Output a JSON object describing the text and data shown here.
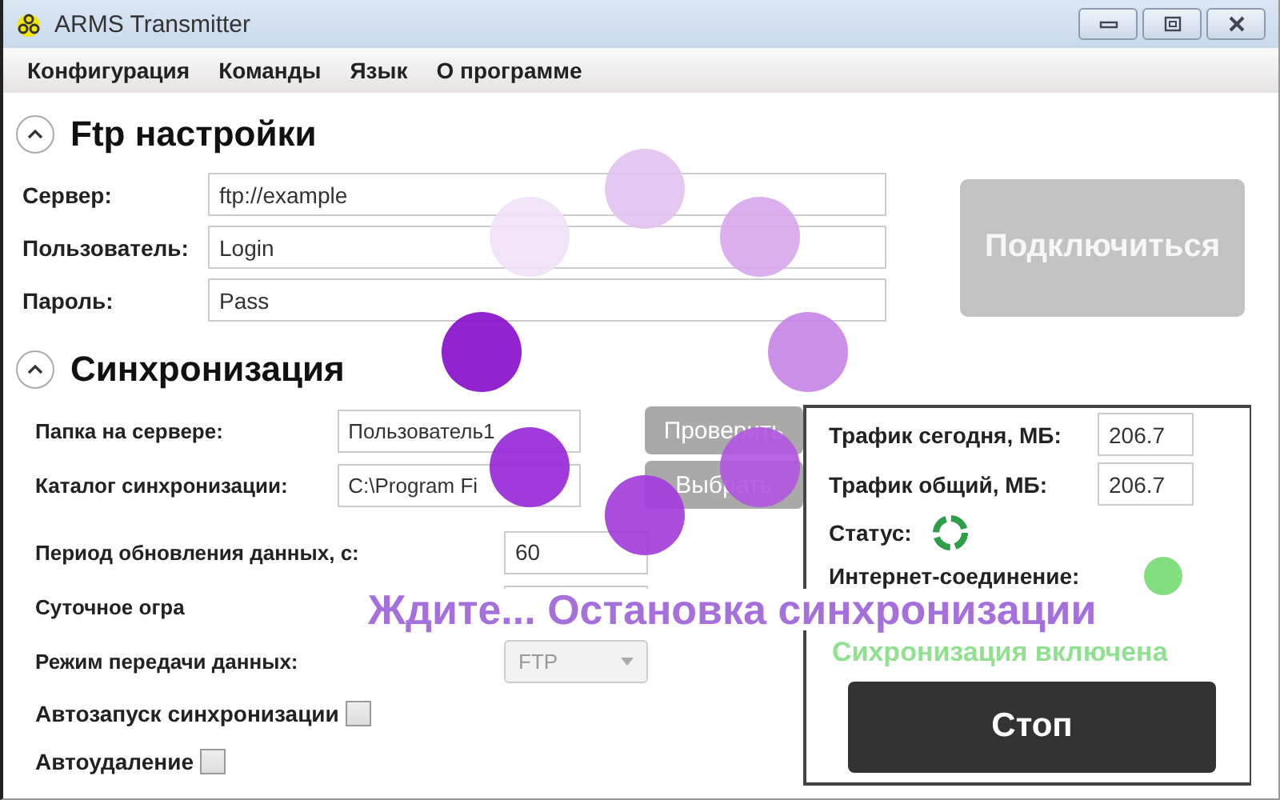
{
  "window": {
    "title": "ARMS Transmitter"
  },
  "menu": [
    "Конфигурация",
    "Команды",
    "Язык",
    "О программе"
  ],
  "ftp": {
    "title": "Ftp настройки",
    "expanded": true,
    "fields": [
      {
        "label": "Сервер:",
        "value": "ftp://example"
      },
      {
        "label": "Пользователь:",
        "value": "Login"
      },
      {
        "label": "Пароль:",
        "value": "Pass"
      }
    ],
    "connect_button": {
      "label": "Подключиться",
      "disabled": true
    }
  },
  "sync": {
    "title": "Синхронизация",
    "expanded": true,
    "rows": [
      {
        "kind": "path",
        "label": "Папка на сервере:",
        "value": "Пользователь1",
        "button": "Проверить",
        "disabled": true
      },
      {
        "kind": "path",
        "label": "Каталог синхронизации:",
        "value": "C:\\Program Fi",
        "button": "Выбрать",
        "disabled": true
      },
      {
        "kind": "number",
        "label": "Период обновления данных, с:",
        "value": "60"
      },
      {
        "kind": "number",
        "label": "Суточное огра"
      },
      {
        "kind": "dropdown",
        "label": "Режим передачи данных:",
        "value": "FTP",
        "disabled": true
      },
      {
        "kind": "checkbox",
        "label": "Автозапуск синхронизации",
        "checked": false
      },
      {
        "kind": "checkbox",
        "label": "Автоудаление",
        "checked": false
      }
    ]
  },
  "stats": {
    "rows": [
      {
        "label": "Трафик сегодня, МБ:",
        "value": "206.7"
      },
      {
        "label": "Трафик общий, МБ:",
        "value": "206.7"
      }
    ],
    "status_label": "Статус:",
    "internet": {
      "label": "Интернет-соединение:",
      "color": "#80e080"
    },
    "message": "Сихронизация включена",
    "stop_button": "Стоп"
  },
  "overlay": {
    "busy": true,
    "message": "Ждите... Остановка синхронизации"
  }
}
